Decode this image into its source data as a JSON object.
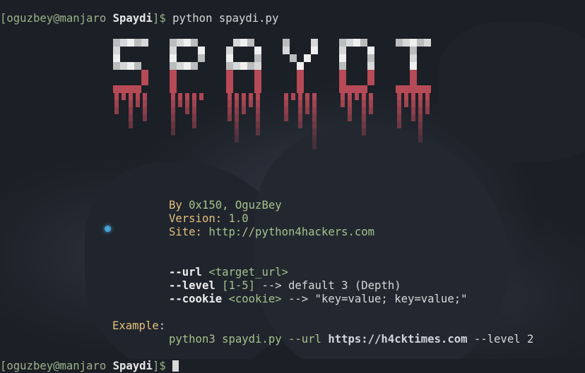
{
  "prompt": {
    "user_host": "[oguzbey@manjaro",
    "dir": "Spaydi",
    "end": "]$",
    "command": "python spaydi.py"
  },
  "banner": {
    "logo_word": "SPAYDI",
    "logo_top_color": "#f2f2f2",
    "logo_drip_color": "#c94f5d",
    "by_label": "By",
    "by_value": "0x150, OguzBey",
    "version_label": "Version:",
    "version_value": "1.0",
    "site_label": "Site:",
    "site_value": "http://python4hackers.com"
  },
  "usage": {
    "url_flag": "--url",
    "url_arg": "<target_url>",
    "level_flag": "--level",
    "level_arg": "[1-5]",
    "level_desc": "--> default 3 (Depth)",
    "cookie_flag": "--cookie",
    "cookie_arg": "<cookie>",
    "cookie_desc": "--> \"key=value; key=value;\""
  },
  "example": {
    "label": "Example",
    "colon": ":",
    "cmd_prefix": "python3 spaydi.py --url",
    "cmd_url": "https://h4cktimes.com",
    "cmd_suffix": "--level 2"
  }
}
